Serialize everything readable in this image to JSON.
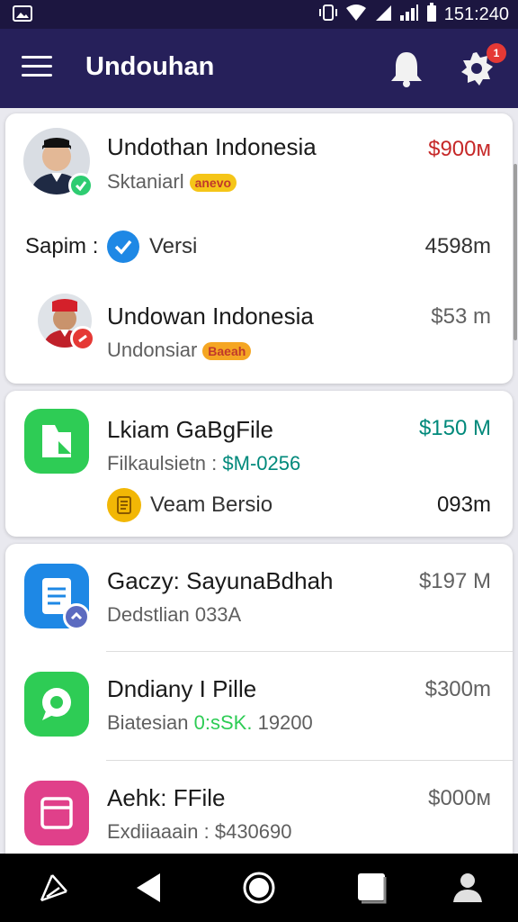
{
  "statusbar": {
    "time": "151:240"
  },
  "appbar": {
    "title": "Undouhan",
    "notification_count": "1"
  },
  "card1": {
    "item1": {
      "title": "Undothan Indonesia",
      "subtitle": "Sktaniarl",
      "tag": "anevo",
      "amount": "$900м"
    },
    "summary": {
      "label": "Sapim :",
      "version_label": "Versi",
      "amount": "4598m"
    },
    "item2": {
      "title": "Undowan Indonesia",
      "subtitle": "Undonsiar",
      "tag": "Baeah",
      "amount": "$53 m"
    }
  },
  "card2": {
    "title": "Lkiam GaBgFile",
    "subtitle_prefix": "Filkaulsietn :",
    "subtitle_value": "$M-0256",
    "amount": "$150 M",
    "version_label": "Veam Bersio",
    "version_amount": "093m"
  },
  "card3": {
    "items": [
      {
        "title": "Gaczy: SayunaBdhah",
        "subtitle": "Dedstlian 033A",
        "amount": "$197 M"
      },
      {
        "title": "Dndiany I Pille",
        "subtitle_prefix": "Biatesian",
        "subtitle_value": "0:sSK.",
        "subtitle_suffix": "19200",
        "amount": "$300m"
      },
      {
        "title": "Aehk: FFile",
        "subtitle": "Exdiiaaain : $430690",
        "amount": "$000м"
      }
    ]
  },
  "colors": {
    "appbar": "#26205a",
    "statusbar": "#1c1640",
    "amount_red": "#c62828",
    "amount_teal": "#00897b",
    "amount_gray": "#616161",
    "accent_blue": "#1e88e5",
    "green_icon": "#2ecc55",
    "blue_icon": "#1e88e5",
    "pink_icon": "#e0408a",
    "yellow_icon": "#f2b705"
  },
  "icons": [
    "menu-icon",
    "bell-icon",
    "settings-icon",
    "check-icon",
    "file-icon",
    "document-icon",
    "location-icon",
    "gallery-icon",
    "nav-back-icon",
    "nav-home-icon",
    "nav-recents-icon",
    "nav-profile-icon"
  ]
}
